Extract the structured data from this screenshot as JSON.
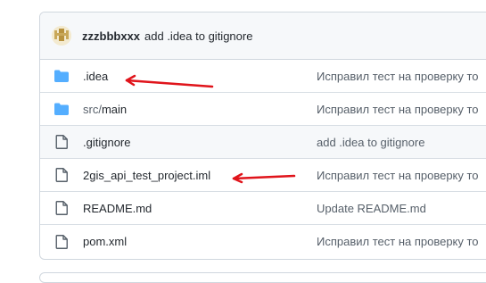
{
  "commit": {
    "author": "zzzbbbxxx",
    "message": "add .idea to gitignore"
  },
  "files": [
    {
      "type": "folder",
      "name": ".idea",
      "dir": "",
      "commit": "Исправил тест на проверку то"
    },
    {
      "type": "folder",
      "name": "main",
      "dir": "src/",
      "commit": "Исправил тест на проверку то"
    },
    {
      "type": "file",
      "name": ".gitignore",
      "dir": "",
      "commit": "add .idea to gitignore"
    },
    {
      "type": "file",
      "name": "2gis_api_test_project.iml",
      "dir": "",
      "commit": "Исправил тест на проверку то"
    },
    {
      "type": "file",
      "name": "README.md",
      "dir": "",
      "commit": "Update README.md"
    },
    {
      "type": "file",
      "name": "pom.xml",
      "dir": "",
      "commit": "Исправил тест на проверку то"
    }
  ],
  "colors": {
    "folder": "#54aeff",
    "file_icon": "#57606a",
    "annotation_arrow": "#e0141b"
  }
}
